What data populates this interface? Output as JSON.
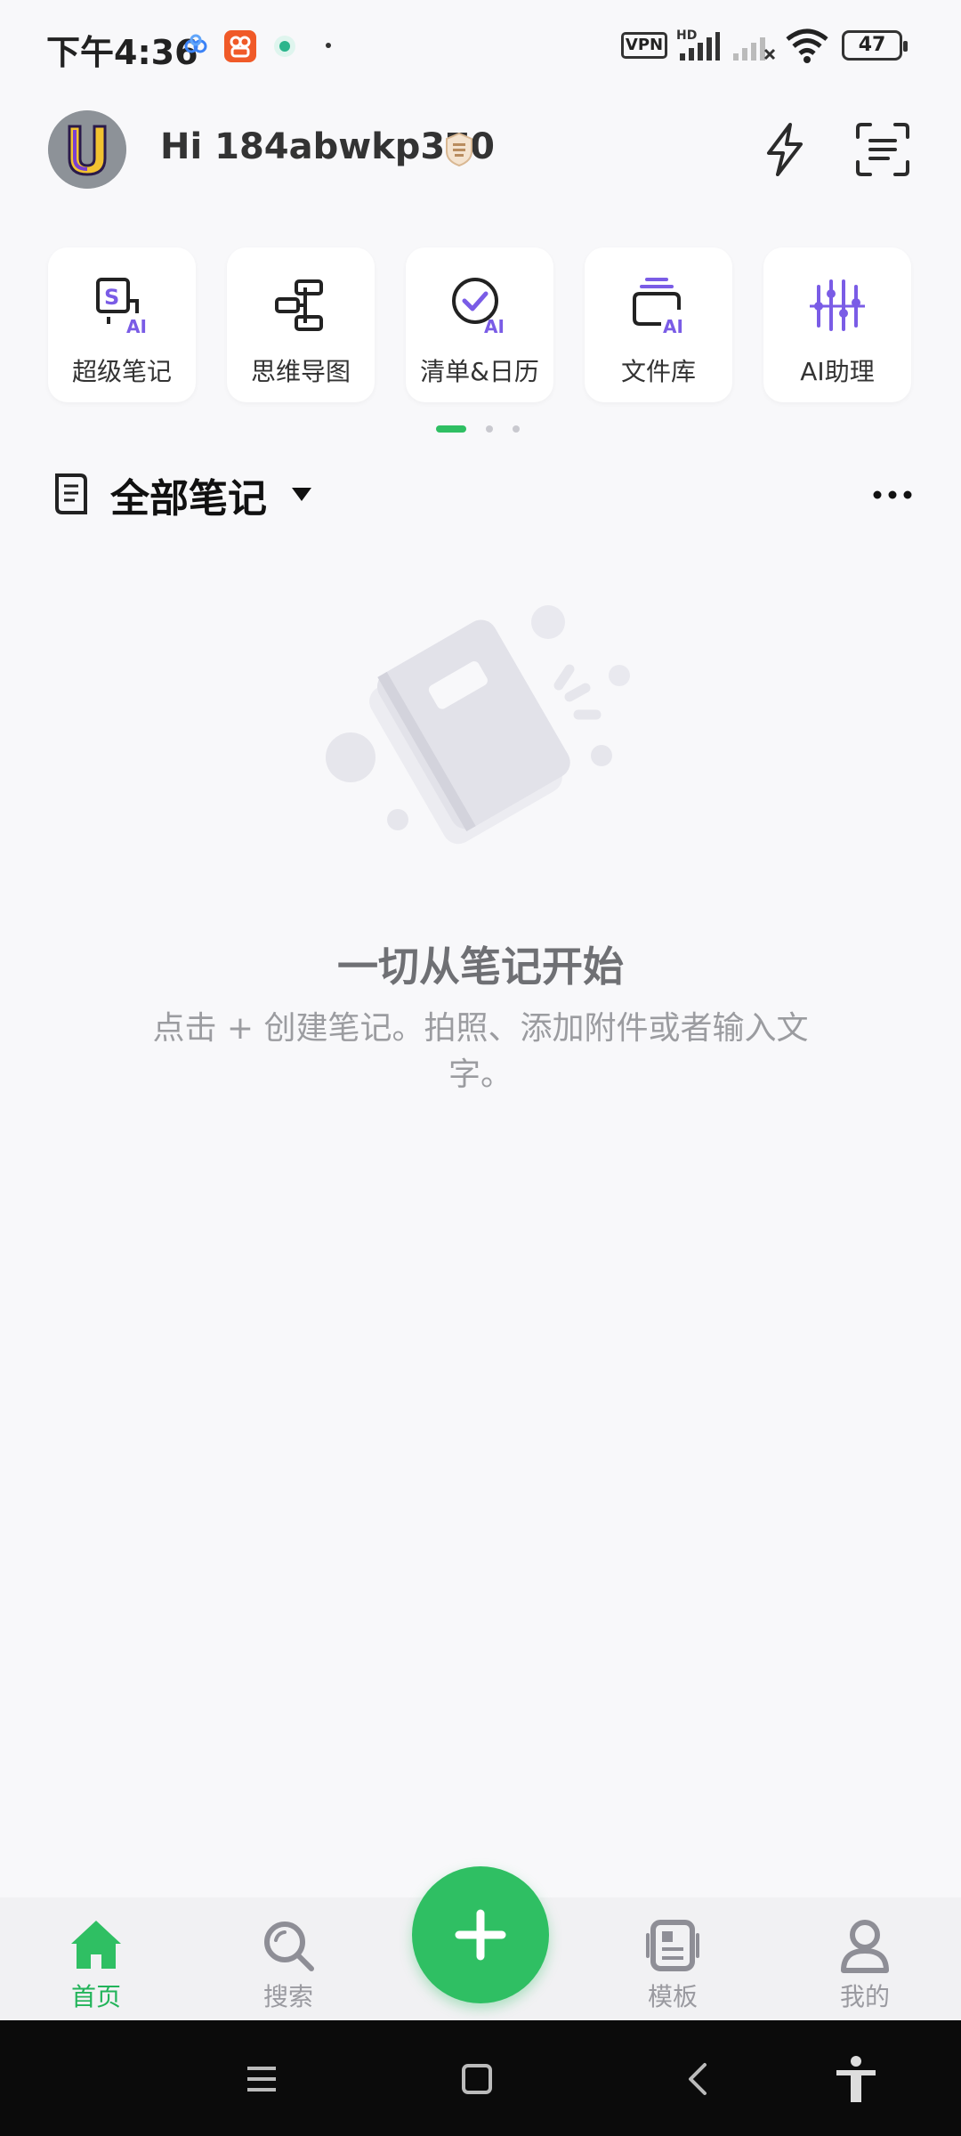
{
  "status_bar": {
    "time": "下午4:36",
    "vpn": "VPN",
    "hd": "HD",
    "battery": "47"
  },
  "header": {
    "greeting": "Hi 184abwkp370",
    "avatar_letter": "U",
    "icons": [
      "flash-icon",
      "scan-icon"
    ]
  },
  "tools": [
    {
      "label": "超级笔记",
      "icon": "super-note-icon"
    },
    {
      "label": "思维导图",
      "icon": "mind-map-icon"
    },
    {
      "label": "清单&日历",
      "icon": "checklist-calendar-icon"
    },
    {
      "label": "文件库",
      "icon": "file-library-icon"
    },
    {
      "label": "AI助理",
      "icon": "ai-assistant-icon"
    }
  ],
  "pager": {
    "active": 0,
    "count": 3
  },
  "section": {
    "title": "全部笔记"
  },
  "empty_state": {
    "title": "一切从笔记开始",
    "description": "点击 + 创建笔记。拍照、添加附件或者输入文字。"
  },
  "tabbar": {
    "tabs": [
      {
        "label": "首页",
        "icon": "home-icon",
        "active": true
      },
      {
        "label": "搜索",
        "icon": "search-icon",
        "active": false
      },
      {
        "label": "模板",
        "icon": "template-icon",
        "active": false
      },
      {
        "label": "我的",
        "icon": "profile-icon",
        "active": false
      }
    ],
    "fab_icon": "plus-icon"
  },
  "colors": {
    "accent": "#2fbf63",
    "ai_purple": "#7a5ce6",
    "background": "#f8f8fa"
  }
}
